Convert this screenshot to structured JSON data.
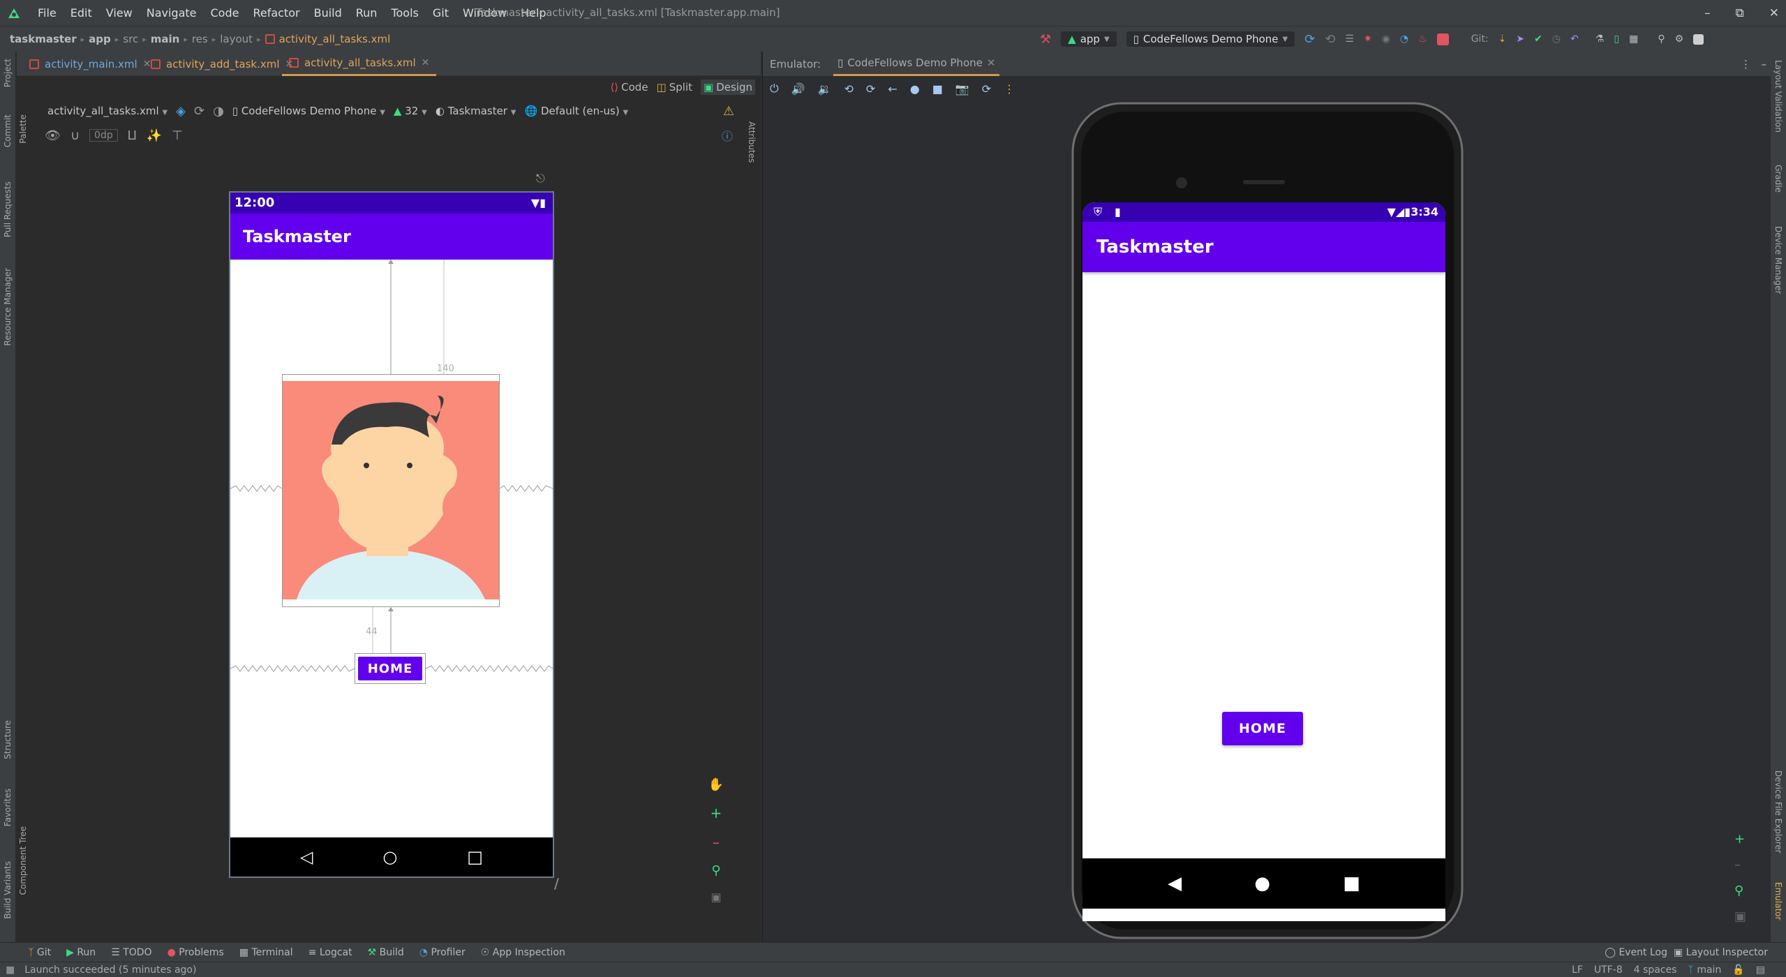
{
  "menubar": {
    "items": [
      "File",
      "Edit",
      "View",
      "Navigate",
      "Code",
      "Refactor",
      "Build",
      "Run",
      "Tools",
      "Git",
      "Window",
      "Help"
    ],
    "window_title": "Taskmaster - activity_all_tasks.xml [Taskmaster.app.main]"
  },
  "breadcrumbs": [
    "taskmaster",
    "app",
    "src",
    "main",
    "res",
    "layout",
    "activity_all_tasks.xml"
  ],
  "toolbar": {
    "run_config": "app",
    "device": "CodeFellows Demo Phone",
    "git_label": "Git:"
  },
  "left_strip": [
    "Project",
    "Commit",
    "Pull Requests",
    "Resource Manager",
    "Structure",
    "Favorites",
    "Build Variants"
  ],
  "left_inner_strip": [
    "Palette",
    "Component Tree"
  ],
  "right_strip": [
    "Layout Validation",
    "Gradle",
    "Device Manager",
    "Device File Explorer",
    "Emulator"
  ],
  "editor": {
    "tabs": [
      {
        "label": "activity_main.xml",
        "active": false
      },
      {
        "label": "activity_add_task.xml",
        "active": false
      },
      {
        "label": "activity_all_tasks.xml",
        "active": true
      }
    ],
    "views": {
      "code": "Code",
      "split": "Split",
      "design": "Design"
    },
    "attributes_label": "Attributes",
    "design_bar": {
      "file": "activity_all_tasks.xml",
      "device": "CodeFellows Demo Phone",
      "api": "32",
      "theme": "Taskmaster",
      "locale": "Default (en-us)"
    },
    "margin_value": "0dp",
    "preview": {
      "status_time": "12:00",
      "app_title": "Taskmaster",
      "constraint_top": "140",
      "constraint_mid": "44",
      "button_label": "HOME"
    }
  },
  "emulator": {
    "label": "Emulator:",
    "tab": "CodeFellows Demo Phone",
    "status_time": "3:34",
    "app_title": "Taskmaster",
    "button_label": "HOME"
  },
  "bottom_tools": [
    "Git",
    "Run",
    "TODO",
    "Problems",
    "Terminal",
    "Logcat",
    "Build",
    "Profiler",
    "App Inspection"
  ],
  "bottom_right_tools": [
    "Event Log",
    "Layout Inspector"
  ],
  "status": {
    "message": "Launch succeeded (5 minutes ago)",
    "line_sep": "LF",
    "encoding": "UTF-8",
    "indent": "4 spaces",
    "branch": "main"
  },
  "colors": {
    "primary": "#6200ee",
    "primary_dark": "#3700b3",
    "ide_bg": "#2b2d30",
    "active_tab": "#d19a4b"
  }
}
